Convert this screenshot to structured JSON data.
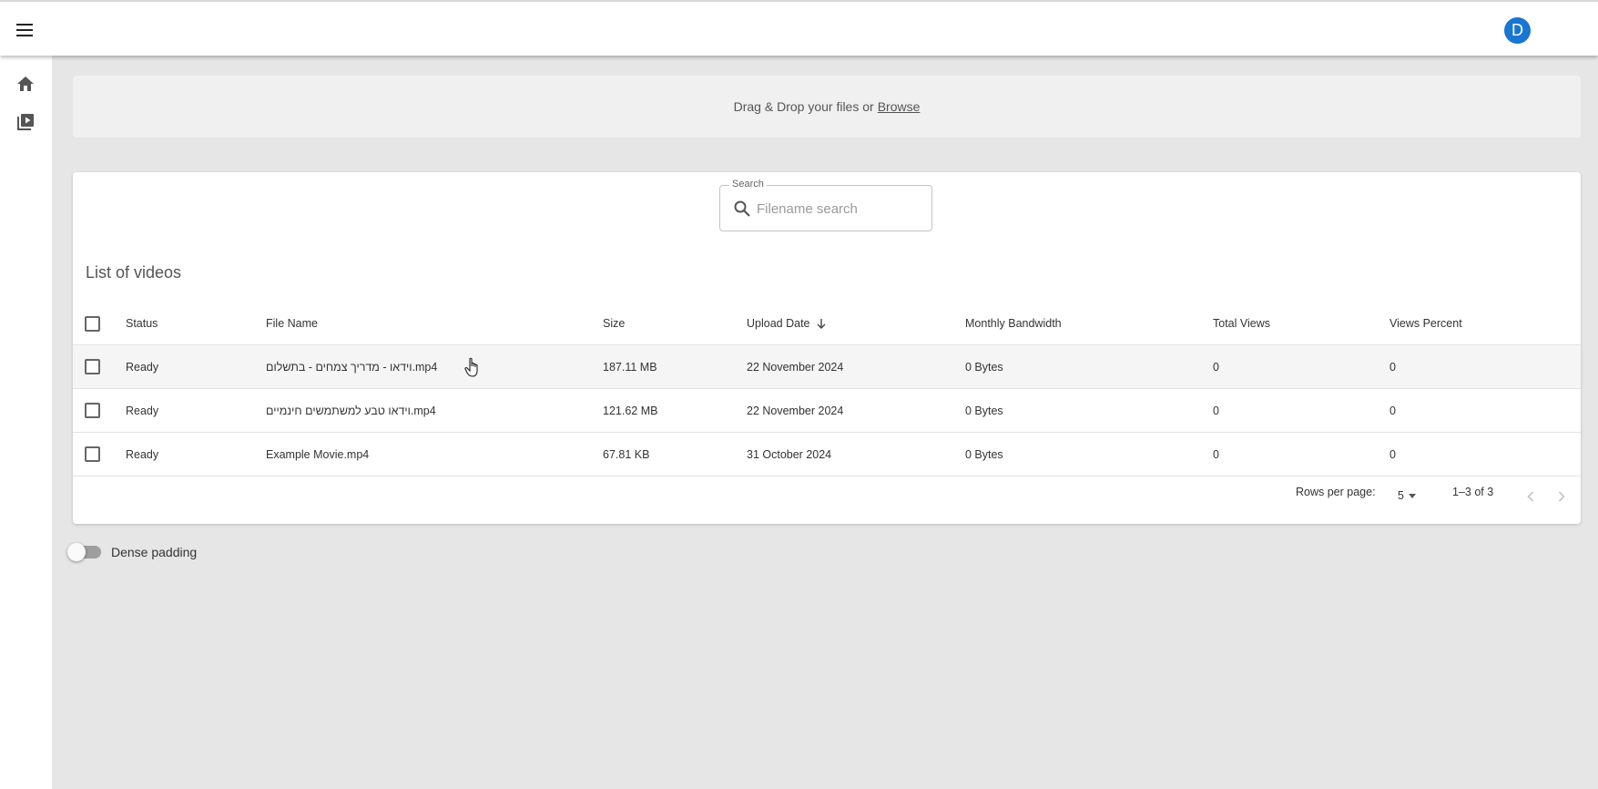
{
  "theme": {
    "accent": "#1976d2"
  },
  "appbar": {
    "menu_icon": "menu-icon",
    "avatar_letter": "D"
  },
  "sidebar": {
    "items": [
      {
        "icon": "home-icon"
      },
      {
        "icon": "video-library-icon"
      }
    ]
  },
  "dropzone": {
    "text": "Drag & Drop your files or",
    "browse": "Browse"
  },
  "search": {
    "legend": "Search",
    "placeholder": "Filename search",
    "value": ""
  },
  "list": {
    "title": "List of videos",
    "columns": [
      "Status",
      "File Name",
      "Size",
      "Upload Date",
      "Monthly Bandwidth",
      "Total Views",
      "Views Percent"
    ],
    "rows": [
      {
        "status": "Ready",
        "name": "וידאו - מדריך צמחים - בתשלום.mp4",
        "size": "187.11 MB",
        "date": "22 November 2024",
        "bandwidth": "0 Bytes",
        "views": "0",
        "percent": "0"
      },
      {
        "status": "Ready",
        "name": "וידאו טבע למשתמשים חינמיים.mp4",
        "size": "121.62 MB",
        "date": "22 November 2024",
        "bandwidth": "0 Bytes",
        "views": "0",
        "percent": "0"
      },
      {
        "status": "Ready",
        "name": "Example Movie.mp4",
        "size": "67.81 KB",
        "date": "31 October 2024",
        "bandwidth": "0 Bytes",
        "views": "0",
        "percent": "0"
      }
    ]
  },
  "pagination": {
    "rows_per_page_label": "Rows per page:",
    "rows_per_page": "5",
    "range": "1–3 of 3"
  },
  "dense_padding": {
    "label": "Dense padding",
    "on": false
  }
}
